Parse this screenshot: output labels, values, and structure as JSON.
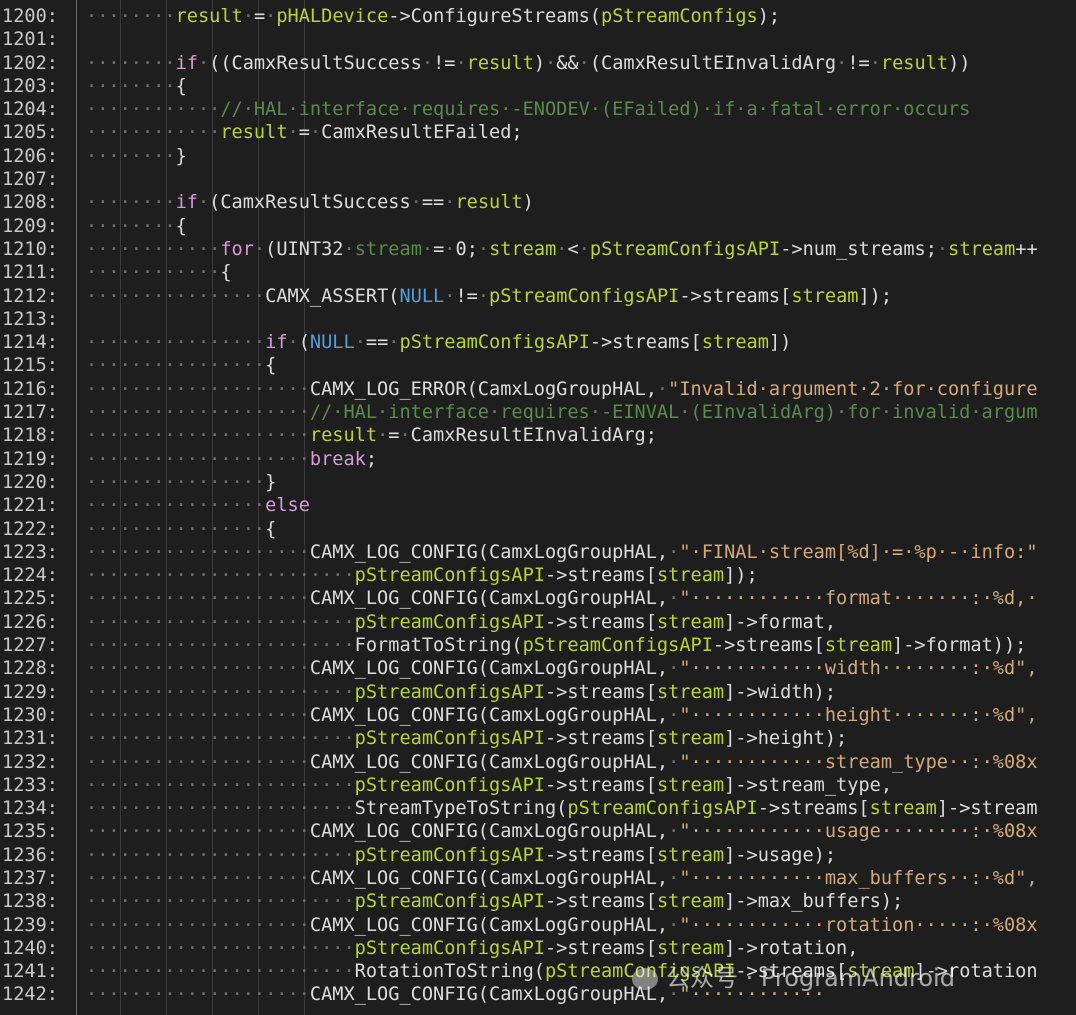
{
  "watermark": "公众号 · ProgramAndroid",
  "lines": [
    {
      "n": "1200:",
      "t": [
        [
          "ws",
          "········"
        ],
        [
          "var",
          "result"
        ],
        [
          "ws",
          "·"
        ],
        [
          "id",
          "="
        ],
        [
          "ws",
          "·"
        ],
        [
          "var",
          "pHALDevice"
        ],
        [
          "id",
          "->ConfigureStreams("
        ],
        [
          "var",
          "pStreamConfigs"
        ],
        [
          "id",
          ");"
        ]
      ]
    },
    {
      "n": "1201:",
      "t": []
    },
    {
      "n": "1202:",
      "t": [
        [
          "ws",
          "········"
        ],
        [
          "kw",
          "if"
        ],
        [
          "ws",
          "·"
        ],
        [
          "id",
          "((CamxResultSuccess"
        ],
        [
          "ws",
          "·"
        ],
        [
          "id",
          "!="
        ],
        [
          "ws",
          "·"
        ],
        [
          "var",
          "result"
        ],
        [
          "id",
          ")"
        ],
        [
          "ws",
          "·"
        ],
        [
          "id",
          "&&"
        ],
        [
          "ws",
          "·"
        ],
        [
          "id",
          "(CamxResultEInvalidArg"
        ],
        [
          "ws",
          "·"
        ],
        [
          "id",
          "!="
        ],
        [
          "ws",
          "·"
        ],
        [
          "var",
          "result"
        ],
        [
          "id",
          "))"
        ]
      ]
    },
    {
      "n": "1203:",
      "t": [
        [
          "ws",
          "········"
        ],
        [
          "id",
          "{"
        ]
      ]
    },
    {
      "n": "1204:",
      "t": [
        [
          "ws",
          "············"
        ],
        [
          "cm",
          "//·HAL·interface·requires·-ENODEV·(EFailed)·if·a·fatal·error·occurs"
        ]
      ]
    },
    {
      "n": "1205:",
      "t": [
        [
          "ws",
          "············"
        ],
        [
          "var",
          "result"
        ],
        [
          "ws",
          "·"
        ],
        [
          "id",
          "="
        ],
        [
          "ws",
          "·"
        ],
        [
          "id",
          "CamxResultEFailed;"
        ]
      ]
    },
    {
      "n": "1206:",
      "t": [
        [
          "ws",
          "········"
        ],
        [
          "id",
          "}"
        ]
      ]
    },
    {
      "n": "1207:",
      "t": []
    },
    {
      "n": "1208:",
      "t": [
        [
          "ws",
          "········"
        ],
        [
          "kw",
          "if"
        ],
        [
          "ws",
          "·"
        ],
        [
          "id",
          "(CamxResultSuccess"
        ],
        [
          "ws",
          "·"
        ],
        [
          "id",
          "=="
        ],
        [
          "ws",
          "·"
        ],
        [
          "var",
          "result"
        ],
        [
          "id",
          ")"
        ]
      ]
    },
    {
      "n": "1209:",
      "t": [
        [
          "ws",
          "········"
        ],
        [
          "id",
          "{"
        ]
      ]
    },
    {
      "n": "1210:",
      "t": [
        [
          "ws",
          "············"
        ],
        [
          "kw",
          "for"
        ],
        [
          "ws",
          "·"
        ],
        [
          "id",
          "(UINT32"
        ],
        [
          "ws",
          "·"
        ],
        [
          "cm",
          "stream"
        ],
        [
          "ws",
          "·"
        ],
        [
          "id",
          "="
        ],
        [
          "ws",
          "·"
        ],
        [
          "id",
          "0;"
        ],
        [
          "ws",
          "·"
        ],
        [
          "var",
          "stream"
        ],
        [
          "ws",
          "·"
        ],
        [
          "id",
          "<"
        ],
        [
          "ws",
          "·"
        ],
        [
          "var",
          "pStreamConfigsAPI"
        ],
        [
          "id",
          "->num_streams;"
        ],
        [
          "ws",
          "·"
        ],
        [
          "var",
          "stream"
        ],
        [
          "id",
          "++"
        ]
      ]
    },
    {
      "n": "1211:",
      "t": [
        [
          "ws",
          "············"
        ],
        [
          "id",
          "{"
        ]
      ]
    },
    {
      "n": "1212:",
      "t": [
        [
          "ws",
          "················"
        ],
        [
          "id",
          "CAMX_ASSERT("
        ],
        [
          "kw2",
          "NULL"
        ],
        [
          "ws",
          "·"
        ],
        [
          "id",
          "!="
        ],
        [
          "ws",
          "·"
        ],
        [
          "var",
          "pStreamConfigsAPI"
        ],
        [
          "id",
          "->streams["
        ],
        [
          "var",
          "stream"
        ],
        [
          "id",
          "]);"
        ]
      ]
    },
    {
      "n": "1213:",
      "t": []
    },
    {
      "n": "1214:",
      "t": [
        [
          "ws",
          "················"
        ],
        [
          "kw",
          "if"
        ],
        [
          "ws",
          "·"
        ],
        [
          "id",
          "("
        ],
        [
          "kw2",
          "NULL"
        ],
        [
          "ws",
          "·"
        ],
        [
          "id",
          "=="
        ],
        [
          "ws",
          "·"
        ],
        [
          "var",
          "pStreamConfigsAPI"
        ],
        [
          "id",
          "->streams["
        ],
        [
          "var",
          "stream"
        ],
        [
          "id",
          "])"
        ]
      ]
    },
    {
      "n": "1215:",
      "t": [
        [
          "ws",
          "················"
        ],
        [
          "id",
          "{"
        ]
      ]
    },
    {
      "n": "1216:",
      "t": [
        [
          "ws",
          "····················"
        ],
        [
          "id",
          "CAMX_LOG_ERROR(CamxLogGroupHAL,"
        ],
        [
          "ws",
          "·"
        ],
        [
          "str",
          "\"Invalid·argument·2·for·configure"
        ]
      ]
    },
    {
      "n": "1217:",
      "t": [
        [
          "ws",
          "····················"
        ],
        [
          "cm",
          "//·HAL·interface·requires·-EINVAL·(EInvalidArg)·for·invalid·argum"
        ]
      ]
    },
    {
      "n": "1218:",
      "t": [
        [
          "ws",
          "····················"
        ],
        [
          "var",
          "result"
        ],
        [
          "ws",
          "·"
        ],
        [
          "id",
          "="
        ],
        [
          "ws",
          "·"
        ],
        [
          "id",
          "CamxResultEInvalidArg;"
        ]
      ]
    },
    {
      "n": "1219:",
      "t": [
        [
          "ws",
          "····················"
        ],
        [
          "kw",
          "break"
        ],
        [
          "id",
          ";"
        ]
      ]
    },
    {
      "n": "1220:",
      "t": [
        [
          "ws",
          "················"
        ],
        [
          "id",
          "}"
        ]
      ]
    },
    {
      "n": "1221:",
      "t": [
        [
          "ws",
          "················"
        ],
        [
          "kw",
          "else"
        ]
      ]
    },
    {
      "n": "1222:",
      "t": [
        [
          "ws",
          "················"
        ],
        [
          "id",
          "{"
        ]
      ]
    },
    {
      "n": "1223:",
      "t": [
        [
          "ws",
          "····················"
        ],
        [
          "id",
          "CAMX_LOG_CONFIG(CamxLogGroupHAL,"
        ],
        [
          "ws",
          "·"
        ],
        [
          "str",
          "\"·FINAL·stream[%d]·=·%p·-·info:\""
        ]
      ]
    },
    {
      "n": "1224:",
      "t": [
        [
          "ws",
          "························"
        ],
        [
          "var",
          "pStreamConfigsAPI"
        ],
        [
          "id",
          "->streams["
        ],
        [
          "var",
          "stream"
        ],
        [
          "id",
          "]);"
        ]
      ]
    },
    {
      "n": "1225:",
      "t": [
        [
          "ws",
          "····················"
        ],
        [
          "id",
          "CAMX_LOG_CONFIG(CamxLogGroupHAL,"
        ],
        [
          "ws",
          "·"
        ],
        [
          "str",
          "\"············format·······:·%d,·"
        ]
      ]
    },
    {
      "n": "1226:",
      "t": [
        [
          "ws",
          "························"
        ],
        [
          "var",
          "pStreamConfigsAPI"
        ],
        [
          "id",
          "->streams["
        ],
        [
          "var",
          "stream"
        ],
        [
          "id",
          "]->format,"
        ]
      ]
    },
    {
      "n": "1227:",
      "t": [
        [
          "ws",
          "························"
        ],
        [
          "id",
          "FormatToString("
        ],
        [
          "var",
          "pStreamConfigsAPI"
        ],
        [
          "id",
          "->streams["
        ],
        [
          "var",
          "stream"
        ],
        [
          "id",
          "]->format));"
        ]
      ]
    },
    {
      "n": "1228:",
      "t": [
        [
          "ws",
          "····················"
        ],
        [
          "id",
          "CAMX_LOG_CONFIG(CamxLogGroupHAL,"
        ],
        [
          "ws",
          "·"
        ],
        [
          "str",
          "\"············width········:·%d\","
        ]
      ]
    },
    {
      "n": "1229:",
      "t": [
        [
          "ws",
          "························"
        ],
        [
          "var",
          "pStreamConfigsAPI"
        ],
        [
          "id",
          "->streams["
        ],
        [
          "var",
          "stream"
        ],
        [
          "id",
          "]->width);"
        ]
      ]
    },
    {
      "n": "1230:",
      "t": [
        [
          "ws",
          "····················"
        ],
        [
          "id",
          "CAMX_LOG_CONFIG(CamxLogGroupHAL,"
        ],
        [
          "ws",
          "·"
        ],
        [
          "str",
          "\"············height·······:·%d\","
        ]
      ]
    },
    {
      "n": "1231:",
      "t": [
        [
          "ws",
          "························"
        ],
        [
          "var",
          "pStreamConfigsAPI"
        ],
        [
          "id",
          "->streams["
        ],
        [
          "var",
          "stream"
        ],
        [
          "id",
          "]->height);"
        ]
      ]
    },
    {
      "n": "1232:",
      "t": [
        [
          "ws",
          "····················"
        ],
        [
          "id",
          "CAMX_LOG_CONFIG(CamxLogGroupHAL,"
        ],
        [
          "ws",
          "·"
        ],
        [
          "str",
          "\"············stream_type··:·%08x"
        ]
      ]
    },
    {
      "n": "1233:",
      "t": [
        [
          "ws",
          "························"
        ],
        [
          "var",
          "pStreamConfigsAPI"
        ],
        [
          "id",
          "->streams["
        ],
        [
          "var",
          "stream"
        ],
        [
          "id",
          "]->stream_type,"
        ]
      ]
    },
    {
      "n": "1234:",
      "t": [
        [
          "ws",
          "························"
        ],
        [
          "id",
          "StreamTypeToString("
        ],
        [
          "var",
          "pStreamConfigsAPI"
        ],
        [
          "id",
          "->streams["
        ],
        [
          "var",
          "stream"
        ],
        [
          "id",
          "]->stream"
        ]
      ]
    },
    {
      "n": "1235:",
      "t": [
        [
          "ws",
          "····················"
        ],
        [
          "id",
          "CAMX_LOG_CONFIG(CamxLogGroupHAL,"
        ],
        [
          "ws",
          "·"
        ],
        [
          "str",
          "\"············usage········:·%08x"
        ]
      ]
    },
    {
      "n": "1236:",
      "t": [
        [
          "ws",
          "························"
        ],
        [
          "var",
          "pStreamConfigsAPI"
        ],
        [
          "id",
          "->streams["
        ],
        [
          "var",
          "stream"
        ],
        [
          "id",
          "]->usage);"
        ]
      ]
    },
    {
      "n": "1237:",
      "t": [
        [
          "ws",
          "····················"
        ],
        [
          "id",
          "CAMX_LOG_CONFIG(CamxLogGroupHAL,"
        ],
        [
          "ws",
          "·"
        ],
        [
          "str",
          "\"············max_buffers··:·%d\","
        ]
      ]
    },
    {
      "n": "1238:",
      "t": [
        [
          "ws",
          "························"
        ],
        [
          "var",
          "pStreamConfigsAPI"
        ],
        [
          "id",
          "->streams["
        ],
        [
          "var",
          "stream"
        ],
        [
          "id",
          "]->max_buffers);"
        ]
      ]
    },
    {
      "n": "1239:",
      "t": [
        [
          "ws",
          "····················"
        ],
        [
          "id",
          "CAMX_LOG_CONFIG(CamxLogGroupHAL,"
        ],
        [
          "ws",
          "·"
        ],
        [
          "str",
          "\"············rotation·····:·%08x"
        ]
      ]
    },
    {
      "n": "1240:",
      "t": [
        [
          "ws",
          "························"
        ],
        [
          "var",
          "pStreamConfigsAPI"
        ],
        [
          "id",
          "->streams["
        ],
        [
          "var",
          "stream"
        ],
        [
          "id",
          "]->rotation,"
        ]
      ]
    },
    {
      "n": "1241:",
      "t": [
        [
          "ws",
          "························"
        ],
        [
          "id",
          "RotationToString("
        ],
        [
          "var",
          "pStreamConfigsAPI"
        ],
        [
          "id",
          "->streams["
        ],
        [
          "var",
          "stream"
        ],
        [
          "id",
          "]->rotation"
        ]
      ]
    },
    {
      "n": "1242:",
      "t": [
        [
          "ws",
          "····················"
        ],
        [
          "id",
          "CAMX_LOG_CONFIG(CamxLogGroupHAL,"
        ],
        [
          "ws",
          "·"
        ],
        [
          "str",
          "\"············"
        ]
      ]
    }
  ]
}
